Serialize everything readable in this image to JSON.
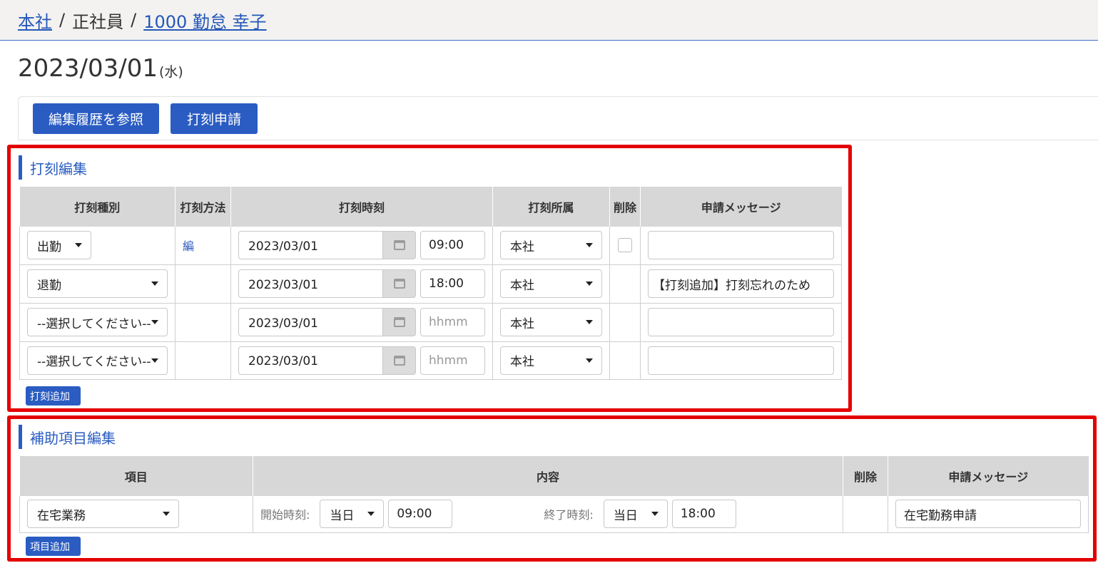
{
  "breadcrumb": {
    "company": "本社",
    "employment_type": "正社員",
    "employee": "1000 勤怠 幸子",
    "sep": "/"
  },
  "date": {
    "value": "2023/03/01",
    "dow": "(水)"
  },
  "toolbar": {
    "history_label": "編集履歴を参照",
    "request_label": "打刻申請"
  },
  "stamp_section": {
    "title": "打刻編集",
    "headers": [
      "打刻種別",
      "打刻方法",
      "打刻時刻",
      "打刻所属",
      "削除",
      "申請メッセージ"
    ],
    "rows": [
      {
        "type": "出勤",
        "method": "編",
        "date": "2023/03/01",
        "time": "09:00",
        "affiliation": "本社",
        "message": ""
      },
      {
        "type": "退勤",
        "method": "",
        "date": "2023/03/01",
        "time": "18:00",
        "affiliation": "本社",
        "message": "【打刻追加】打刻忘れのため"
      },
      {
        "type": "--選択してください--",
        "method": "",
        "date": "2023/03/01",
        "time": "",
        "time_placeholder": "hhmm",
        "affiliation": "本社",
        "message": ""
      },
      {
        "type": "--選択してください--",
        "method": "",
        "date": "2023/03/01",
        "time": "",
        "time_placeholder": "hhmm",
        "affiliation": "本社",
        "message": ""
      }
    ],
    "add_label": "打刻追加"
  },
  "aux_section": {
    "title": "補助項目編集",
    "headers": [
      "項目",
      "内容",
      "削除",
      "申請メッセージ"
    ],
    "row": {
      "item": "在宅業務",
      "start_label": "開始時刻:",
      "start_day": "当日",
      "start_time": "09:00",
      "end_label": "終了時刻:",
      "end_day": "当日",
      "end_time": "18:00",
      "message": "在宅勤務申請"
    },
    "add_label": "項目追加"
  },
  "colors": {
    "accent": "#2a5cc2",
    "highlight": "#e30000",
    "header_bg": "#d7d7d7"
  }
}
